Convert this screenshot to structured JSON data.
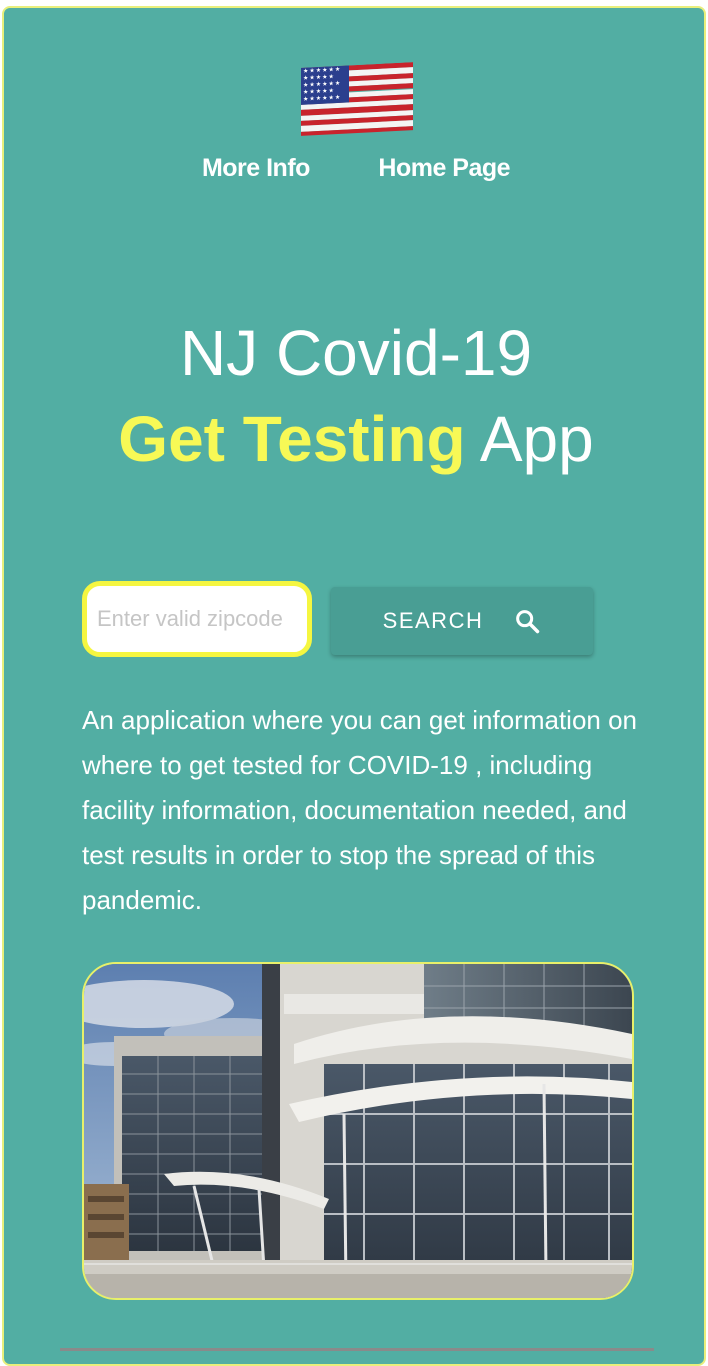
{
  "nav": {
    "more_info": "More Info",
    "home_page": "Home Page"
  },
  "hero": {
    "title_line1": "NJ Covid-19",
    "title_accent": "Get Testing",
    "title_suffix": "App"
  },
  "search": {
    "placeholder": "Enter valid zipcode",
    "value": "",
    "button_label": "SEARCH",
    "button_icon": "search-icon"
  },
  "description": "An application where you can get information on where to get tested for COVID-19 , including facility information, documentation needed, and test results in order to stop the spread of this pandemic.",
  "icons": {
    "flag": "us-flag-icon",
    "search": "search-icon"
  },
  "colors": {
    "background": "#52aea3",
    "accent": "#f7f956",
    "button": "#499e94",
    "input_border": "#f5f640"
  }
}
